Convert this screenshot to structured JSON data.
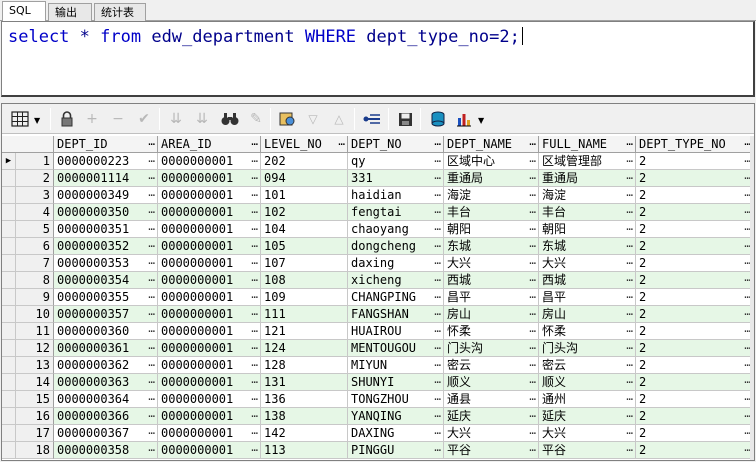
{
  "tabs": [
    {
      "label": "SQL",
      "active": true
    },
    {
      "label": "输出",
      "active": false
    },
    {
      "label": "统计表",
      "active": false
    }
  ],
  "sql": {
    "select": "select",
    "star": " * ",
    "from": "from",
    "table": " edw_department ",
    "where": "WHERE",
    "cond": " dept_type_no=2;"
  },
  "toolbar": {
    "icons": [
      "grid-icon",
      "lock-icon",
      "add-icon",
      "remove-icon",
      "check-icon",
      "sort-down-icon",
      "sort-down-alt-icon",
      "binoculars-icon",
      "eraser-icon",
      "query-icon",
      "arrow-down-icon",
      "arrow-up-icon",
      "link-icon",
      "save-icon",
      "database-icon",
      "chart-icon"
    ]
  },
  "grid": {
    "columns": [
      "DEPT_ID",
      "AREA_ID",
      "LEVEL_NO",
      "DEPT_NO",
      "DEPT_NAME",
      "FULL_NAME",
      "DEPT_TYPE_NO"
    ],
    "current_row_marker": "▶",
    "rows": [
      {
        "n": "1",
        "cells": [
          "0000000223",
          "0000000001",
          "202",
          "qy",
          "区域中心",
          "区域管理部",
          "2"
        ]
      },
      {
        "n": "2",
        "cells": [
          "0000001114",
          "0000000001",
          "094",
          "331",
          "重通局",
          "重通局",
          "2"
        ]
      },
      {
        "n": "3",
        "cells": [
          "0000000349",
          "0000000001",
          "101",
          "haidian",
          "海淀",
          "海淀",
          "2"
        ]
      },
      {
        "n": "4",
        "cells": [
          "0000000350",
          "0000000001",
          "102",
          "fengtai",
          "丰台",
          "丰台",
          "2"
        ]
      },
      {
        "n": "5",
        "cells": [
          "0000000351",
          "0000000001",
          "104",
          "chaoyang",
          "朝阳",
          "朝阳",
          "2"
        ]
      },
      {
        "n": "6",
        "cells": [
          "0000000352",
          "0000000001",
          "105",
          "dongcheng",
          "东城",
          "东城",
          "2"
        ]
      },
      {
        "n": "7",
        "cells": [
          "0000000353",
          "0000000001",
          "107",
          "daxing",
          "大兴",
          "大兴",
          "2"
        ]
      },
      {
        "n": "8",
        "cells": [
          "0000000354",
          "0000000001",
          "108",
          "xicheng",
          "西城",
          "西城",
          "2"
        ]
      },
      {
        "n": "9",
        "cells": [
          "0000000355",
          "0000000001",
          "109",
          "CHANGPING",
          "昌平",
          "昌平",
          "2"
        ]
      },
      {
        "n": "10",
        "cells": [
          "0000000357",
          "0000000001",
          "111",
          "FANGSHAN",
          "房山",
          "房山",
          "2"
        ]
      },
      {
        "n": "11",
        "cells": [
          "0000000360",
          "0000000001",
          "121",
          "HUAIROU",
          "怀柔",
          "怀柔",
          "2"
        ]
      },
      {
        "n": "12",
        "cells": [
          "0000000361",
          "0000000001",
          "124",
          "MENTOUGOU",
          "门头沟",
          "门头沟",
          "2"
        ]
      },
      {
        "n": "13",
        "cells": [
          "0000000362",
          "0000000001",
          "128",
          "MIYUN",
          "密云",
          "密云",
          "2"
        ]
      },
      {
        "n": "14",
        "cells": [
          "0000000363",
          "0000000001",
          "131",
          "SHUNYI",
          "顺义",
          "顺义",
          "2"
        ]
      },
      {
        "n": "15",
        "cells": [
          "0000000364",
          "0000000001",
          "136",
          "TONGZHOU",
          "通县",
          "通州",
          "2"
        ]
      },
      {
        "n": "16",
        "cells": [
          "0000000366",
          "0000000001",
          "138",
          "YANQING",
          "延庆",
          "延庆",
          "2"
        ]
      },
      {
        "n": "17",
        "cells": [
          "0000000367",
          "0000000001",
          "142",
          "DAXING",
          "大兴",
          "大兴",
          "2"
        ]
      },
      {
        "n": "18",
        "cells": [
          "0000000358",
          "0000000001",
          "113",
          "PINGGU",
          "平谷",
          "平谷",
          "2"
        ]
      }
    ]
  },
  "colors": {
    "alt_row": "#e6f7e6",
    "keyword": "#0000c8"
  }
}
